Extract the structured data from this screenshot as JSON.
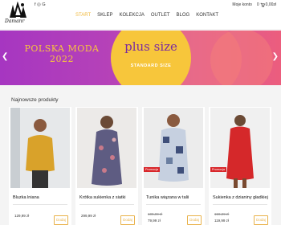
{
  "brand": {
    "name": "Damanr"
  },
  "social_icons": [
    "facebook-icon",
    "instagram-icon",
    "google-icon"
  ],
  "nav": [
    "START",
    "SKLEP",
    "KOLEKCJA",
    "OUTLET",
    "BLOG",
    "KONTAKT"
  ],
  "account": {
    "label": "Moje konto",
    "cart_count": "0",
    "cart_total": "0,00zł"
  },
  "banner": {
    "title_line1": "POLSKA MODA",
    "title_line2": "2022",
    "headline": "plus size",
    "subline": "STANDARD SIZE"
  },
  "section": {
    "title": "Najnowsze produkty"
  },
  "products": [
    {
      "name": "Bluzka lniana",
      "price": "129,99 zł",
      "old_price": "",
      "badge": "",
      "button": "Dodaj",
      "color": "#d9a22a"
    },
    {
      "name": "Krótka sukienka z siatki",
      "price": "299,99 zł",
      "old_price": "",
      "badge": "",
      "button": "Dodaj",
      "color": "#5e5c82"
    },
    {
      "name": "Tunika wiązana w talii",
      "price": "109,99 zł",
      "old_price": "79,99 zł",
      "badge": "Promocja",
      "button": "Dodaj",
      "color": "#6a7ea0"
    },
    {
      "name": "Sukienka z dzianiny gładkiej",
      "price": "159,99 zł",
      "old_price": "119,99 zł",
      "badge": "Promocja",
      "button": "Dodaj",
      "color": "#d5282a"
    }
  ],
  "colors": {
    "accent": "#f0b83a",
    "promo": "#d8262a",
    "banner_left": "#a636c1",
    "banner_right": "#ec5d7d",
    "circle": "#f7c63b"
  }
}
